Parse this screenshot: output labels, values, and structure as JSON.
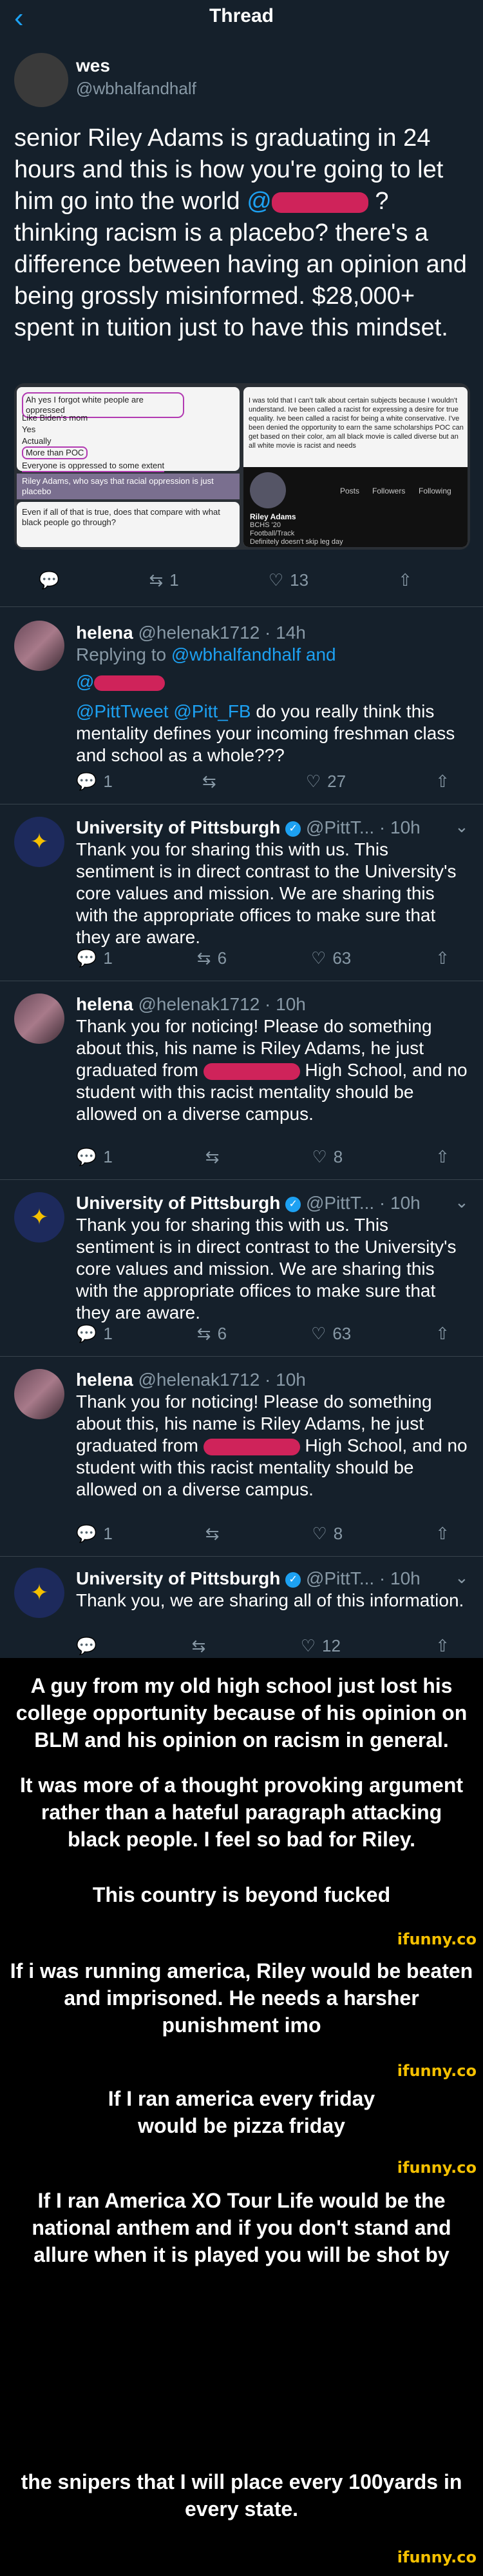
{
  "header": {
    "title": "Thread"
  },
  "op": {
    "name": "wes",
    "handle": "@wbhalfandhalf",
    "text_a": "senior Riley Adams is graduating in 24 hours and this is how you're going to let him go into the world ",
    "mention": "@",
    "text_b": " ?",
    "text_c": "thinking racism is a placebo? there's a difference between having an opinion and being grossly misinformed. $28,000+ spent in tuition just to have this mindset.",
    "stats": {
      "retweets": "1",
      "likes": "13"
    },
    "embedded": {
      "left_a": "Ah yes I forgot white people are oppressed",
      "left_b": "Like Biden's mom",
      "left_c": "Yes",
      "left_d": "Actually",
      "left_e": "More than POC",
      "left_f": "Everyone is oppressed to some extent",
      "mid_a": "Riley Adams, who says that racial oppression is just placebo",
      "mid_b": "Even if all of that is true, does that compare with what black people go through?",
      "right_a": "I was told that I can't talk about certain subjects because I wouldn't understand. Ive been called a racist for expressing a desire for true equality. Ive been called a racist for being a white conservative. I've been denied the opportunity to earn the same scholarships POC can get based on their color, am all black movie is called diverse but an all white movie is racist and needs",
      "right_b": "Posts",
      "right_c": "Followers",
      "right_d": "Following",
      "right_e": "Riley Adams",
      "right_f": "BCHS '20",
      "right_g": "Football/Track",
      "right_h": "Definitely doesn't skip leg day"
    }
  },
  "replies": [
    {
      "name": "helena",
      "meta": "@helenak1712 · 14h",
      "replying": "Replying to ",
      "replying_link": "@wbhalfandhalf and",
      "at": "@",
      "text_link": "@PittTweet @Pitt_FB",
      "text": " do you really think this mentality defines your incoming freshman class and school as a whole???",
      "replies": "1",
      "retweets": "",
      "likes": "27"
    },
    {
      "name": "University of Pittsburgh",
      "meta": "@PittT... · 10h",
      "text": "Thank you for sharing this with us. This sentiment is in direct contrast to the University's core values and mission. We are sharing this with the appropriate offices to make sure that they are aware.",
      "replies": "1",
      "retweets": "6",
      "likes": "63"
    },
    {
      "name": "helena",
      "meta": "@helenak1712 · 10h",
      "text_a": "Thank you for noticing! Please do something about this, his name is Riley Adams, he just graduated from",
      "text_b": "High School, and no student with this racist mentality should be allowed on a diverse campus.",
      "replies": "1",
      "retweets": "",
      "likes": "8"
    },
    {
      "name": "University of Pittsburgh",
      "meta": "@PittT... · 10h",
      "text": "Thank you for sharing this with us. This sentiment is in direct contrast to the University's core values and mission. We are sharing this with the appropriate offices to make sure that they are aware.",
      "replies": "1",
      "retweets": "6",
      "likes": "63"
    },
    {
      "name": "helena",
      "meta": "@helenak1712 · 10h",
      "text_a": "Thank you for noticing! Please do something about this, his name is Riley Adams, he just graduated from",
      "text_b": "High School, and no student with this racist mentality should be allowed on a diverse campus.",
      "replies": "1",
      "retweets": "",
      "likes": "8"
    },
    {
      "name": "University of Pittsburgh",
      "meta": "@PittT... · 10h",
      "text": "Thank you, we are sharing all of this information.",
      "replies": "",
      "retweets": "",
      "likes": "12"
    }
  ],
  "meme": {
    "p1": "A guy from my old high school just lost his college opportunity because of his opinion on BLM and his opinion on racism in general.",
    "p2": "It was more of a thought provoking argument rather than a hateful paragraph attacking black people. I feel so bad for Riley.",
    "p3": "This country is beyond fucked",
    "c1": "If i was running america, Riley would be beaten and imprisoned. He needs a harsher punishment imo",
    "c2": "If I ran america every friday would be pizza friday",
    "c3a": "If I ran America XO Tour Life would be the national anthem and if you don't stand and allure when it is played you will be shot by",
    "c3b": "the snipers that I will place every 100yards in every state.",
    "watermark": "ifunny.co"
  },
  "colors": {
    "bg": "#15202b",
    "accent": "#1da1f2",
    "muted": "#8899a6",
    "redact": "#e0245e",
    "watermark": "#f5c000"
  }
}
